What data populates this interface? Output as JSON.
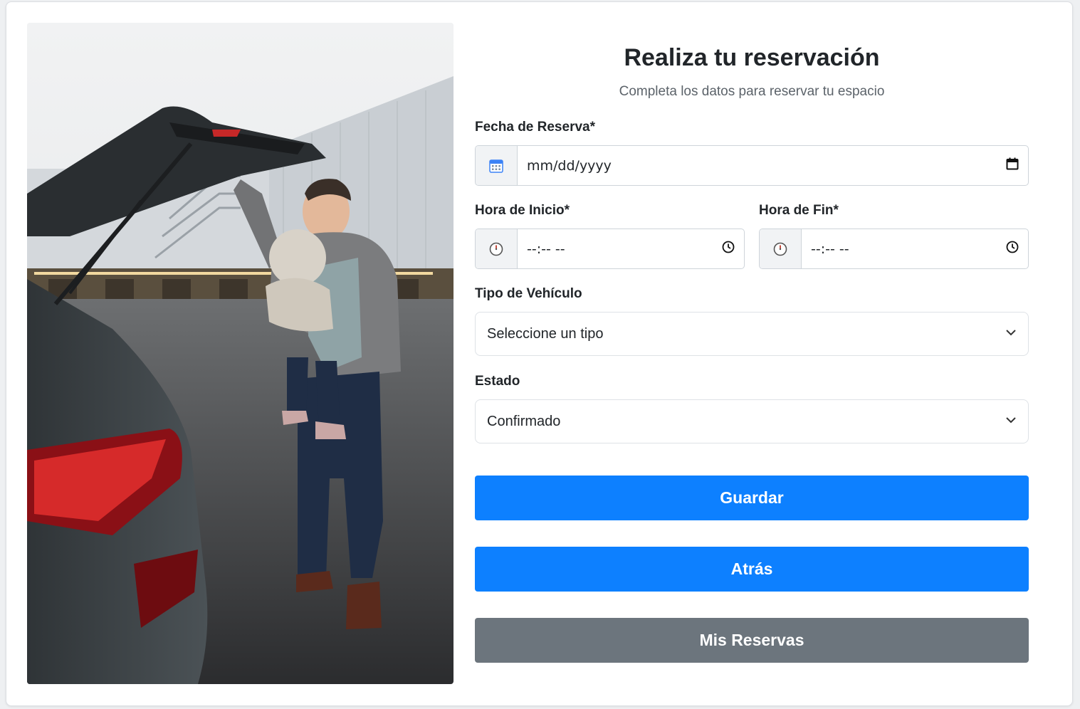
{
  "form": {
    "title": "Realiza tu reservación",
    "subtitle": "Completa los datos para reservar tu espacio",
    "fecha": {
      "label": "Fecha de Reserva*",
      "placeholder": "mm/dd/yyyy"
    },
    "hora_inicio": {
      "label": "Hora de Inicio*",
      "placeholder": "--:-- --"
    },
    "hora_fin": {
      "label": "Hora de Fin*",
      "placeholder": "--:-- --"
    },
    "tipo_vehiculo": {
      "label": "Tipo de Vehículo",
      "selected": "Seleccione un tipo"
    },
    "estado": {
      "label": "Estado",
      "selected": "Confirmado"
    }
  },
  "buttons": {
    "guardar": "Guardar",
    "atras": "Atrás",
    "mis_reservas": "Mis Reservas"
  },
  "colors": {
    "primary": "#0d80ff",
    "secondary": "#6c757d",
    "calendar_icon": "#3b82f6"
  },
  "icons": {
    "fecha_addon": "calendar-icon",
    "fecha_picker": "calendar-picker-icon",
    "hora_addon": "clock-icon",
    "hora_picker": "clock-picker-icon",
    "select_arrow": "chevron-down-icon"
  }
}
